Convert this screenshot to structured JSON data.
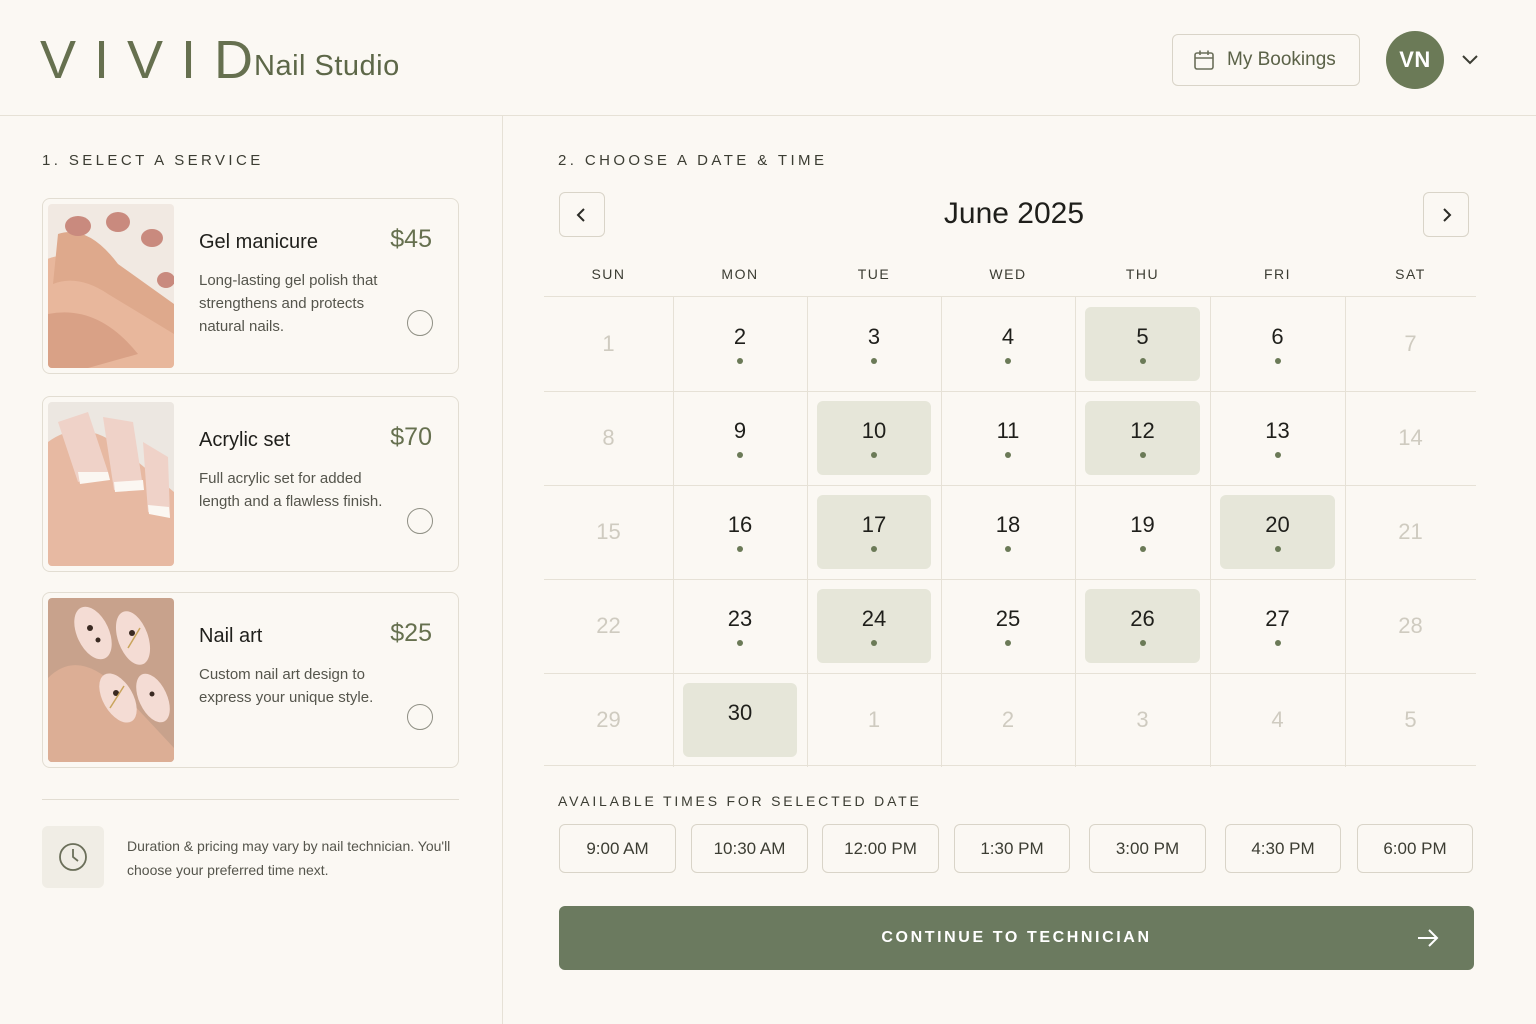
{
  "header": {
    "logo": "VIVID",
    "logo_sub": "Nail Studio",
    "bookings_label": "My Bookings",
    "avatar_initials": "VN"
  },
  "services": {
    "title": "1. SELECT A SERVICE",
    "items": [
      {
        "name": "Gel manicure",
        "price": "$45",
        "desc": "Long-lasting gel polish that strengthens and protects natural nails."
      },
      {
        "name": "Acrylic set",
        "price": "$70",
        "desc": "Full acrylic set for added length and a flawless finish."
      },
      {
        "name": "Nail art",
        "price": "$25",
        "desc": "Custom nail art design to express your unique style."
      }
    ],
    "note": "Duration & pricing may vary by nail technician. You'll choose your preferred time next."
  },
  "calendar": {
    "title": "2. CHOOSE A DATE & TIME",
    "month": "June 2025",
    "weekdays": [
      "SUN",
      "MON",
      "TUE",
      "WED",
      "THU",
      "FRI",
      "SAT"
    ],
    "weeks": [
      [
        {
          "d": "1",
          "m": true
        },
        {
          "d": "2",
          "a": true
        },
        {
          "d": "3",
          "a": true
        },
        {
          "d": "4",
          "a": true
        },
        {
          "d": "5",
          "a": true,
          "h": true
        },
        {
          "d": "6",
          "a": true
        },
        {
          "d": "7",
          "m": true
        }
      ],
      [
        {
          "d": "8",
          "m": true
        },
        {
          "d": "9",
          "a": true
        },
        {
          "d": "10",
          "a": true,
          "h": true
        },
        {
          "d": "11",
          "a": true
        },
        {
          "d": "12",
          "a": true,
          "h": true
        },
        {
          "d": "13",
          "a": true
        },
        {
          "d": "14",
          "m": true
        }
      ],
      [
        {
          "d": "15",
          "m": true
        },
        {
          "d": "16",
          "a": true
        },
        {
          "d": "17",
          "a": true,
          "h": true
        },
        {
          "d": "18",
          "a": true
        },
        {
          "d": "19",
          "a": true
        },
        {
          "d": "20",
          "a": true,
          "h": true
        },
        {
          "d": "21",
          "m": true
        }
      ],
      [
        {
          "d": "22",
          "m": true
        },
        {
          "d": "23",
          "a": true
        },
        {
          "d": "24",
          "a": true,
          "h": true
        },
        {
          "d": "25",
          "a": true
        },
        {
          "d": "26",
          "a": true,
          "h": true
        },
        {
          "d": "27",
          "a": true
        },
        {
          "d": "28",
          "m": true
        }
      ],
      [
        {
          "d": "29",
          "m": true
        },
        {
          "d": "30",
          "h": true
        },
        {
          "d": "1",
          "m": true
        },
        {
          "d": "2",
          "m": true
        },
        {
          "d": "3",
          "m": true
        },
        {
          "d": "4",
          "m": true
        },
        {
          "d": "5",
          "m": true
        }
      ]
    ]
  },
  "times": {
    "title": "AVAILABLE TIMES FOR SELECTED DATE",
    "slots": [
      "9:00 AM",
      "10:30 AM",
      "12:00 PM",
      "1:30 PM",
      "3:00 PM",
      "4:30 PM",
      "6:00 PM"
    ]
  },
  "cta": {
    "label": "CONTINUE TO TECHNICIAN"
  },
  "colors": {
    "accent": "#6b7a57",
    "highlight": "#e6e6d9",
    "background": "#fbf8f3"
  }
}
